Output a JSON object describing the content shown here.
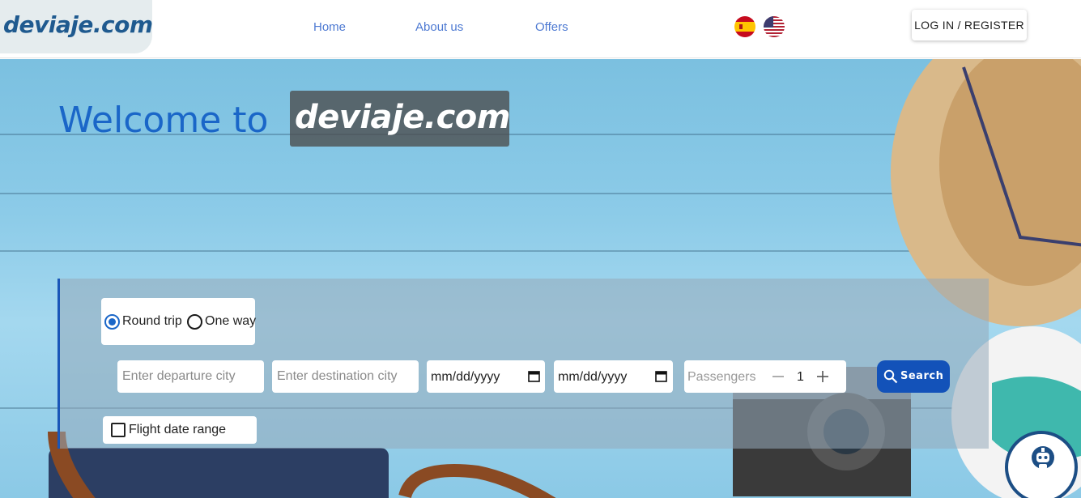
{
  "brand": {
    "logo_text": "deviaje.com"
  },
  "nav": {
    "items": [
      {
        "label": "Home"
      },
      {
        "label": "About us"
      },
      {
        "label": "Offers"
      }
    ],
    "login_label": "LOG IN / REGISTER"
  },
  "hero": {
    "welcome_text": "Welcome to",
    "welcome_logo": "deviaje.com"
  },
  "search": {
    "trip_types": [
      {
        "label": "Round trip",
        "selected": true
      },
      {
        "label": "One way",
        "selected": false
      }
    ],
    "departure_placeholder": "Enter departure city",
    "destination_placeholder": "Enter destination city",
    "date_start": "mm/dd/yyyy",
    "date_end": "mm/dd/yyyy",
    "passengers_label": "Passengers",
    "passengers_count": "1",
    "search_label": "Search",
    "date_range_label": "Flight date range",
    "date_range_checked": false
  },
  "colors": {
    "accent": "#1a66c8",
    "search_button": "#1352b9",
    "nav_link": "#4e7ad2",
    "logo": "#1f5a8f"
  },
  "icons": [
    "spain-flag-icon",
    "usa-flag-icon",
    "calendar-icon",
    "minus-icon",
    "plus-icon",
    "search-icon",
    "chatbot-icon"
  ]
}
